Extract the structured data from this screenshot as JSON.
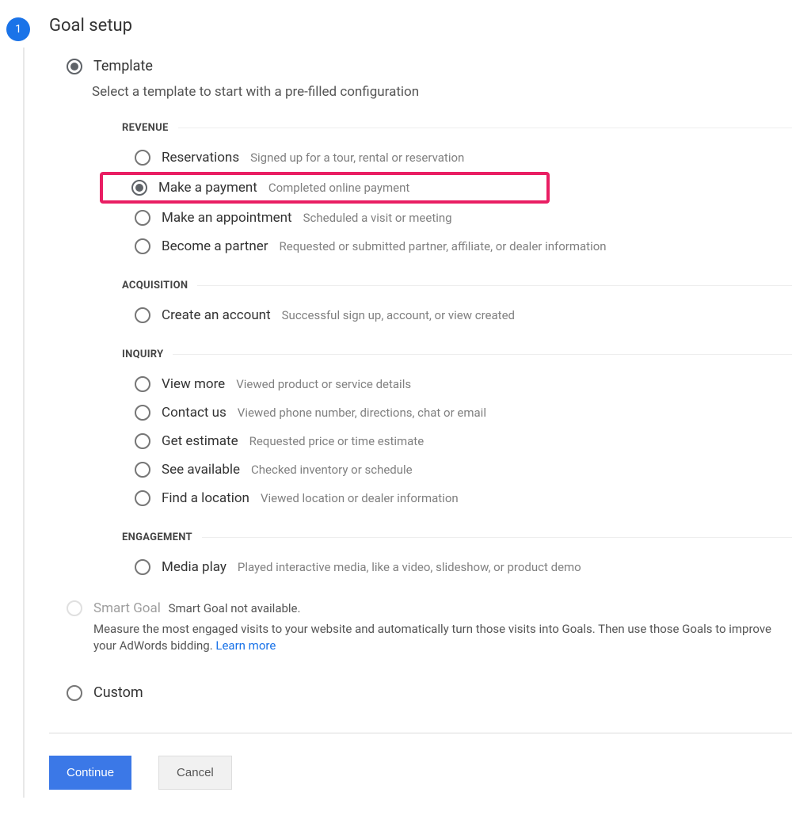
{
  "step": {
    "number": "1",
    "title": "Goal setup"
  },
  "template": {
    "label": "Template",
    "description": "Select a template to start with a pre-filled configuration"
  },
  "categories": [
    {
      "title": "REVENUE",
      "options": [
        {
          "title": "Reservations",
          "desc": "Signed up for a tour, rental or reservation",
          "selected": false,
          "highlight": false
        },
        {
          "title": "Make a payment",
          "desc": "Completed online payment",
          "selected": true,
          "highlight": true
        },
        {
          "title": "Make an appointment",
          "desc": "Scheduled a visit or meeting",
          "selected": false,
          "highlight": false
        },
        {
          "title": "Become a partner",
          "desc": "Requested or submitted partner, affiliate, or dealer information",
          "selected": false,
          "highlight": false
        }
      ]
    },
    {
      "title": "ACQUISITION",
      "options": [
        {
          "title": "Create an account",
          "desc": "Successful sign up, account, or view created",
          "selected": false,
          "highlight": false
        }
      ]
    },
    {
      "title": "INQUIRY",
      "options": [
        {
          "title": "View more",
          "desc": "Viewed product or service details",
          "selected": false,
          "highlight": false
        },
        {
          "title": "Contact us",
          "desc": "Viewed phone number, directions, chat or email",
          "selected": false,
          "highlight": false
        },
        {
          "title": "Get estimate",
          "desc": "Requested price or time estimate",
          "selected": false,
          "highlight": false
        },
        {
          "title": "See available",
          "desc": "Checked inventory or schedule",
          "selected": false,
          "highlight": false
        },
        {
          "title": "Find a location",
          "desc": "Viewed location or dealer information",
          "selected": false,
          "highlight": false
        }
      ]
    },
    {
      "title": "ENGAGEMENT",
      "options": [
        {
          "title": "Media play",
          "desc": "Played interactive media, like a video, slideshow, or product demo",
          "selected": false,
          "highlight": false
        }
      ]
    }
  ],
  "smartGoal": {
    "title": "Smart Goal",
    "unavailable": "Smart Goal not available.",
    "description": "Measure the most engaged visits to your website and automatically turn those visits into Goals. Then use those Goals to improve your AdWords bidding. ",
    "learnMore": "Learn more"
  },
  "custom": {
    "label": "Custom"
  },
  "buttons": {
    "continue": "Continue",
    "cancel": "Cancel"
  }
}
